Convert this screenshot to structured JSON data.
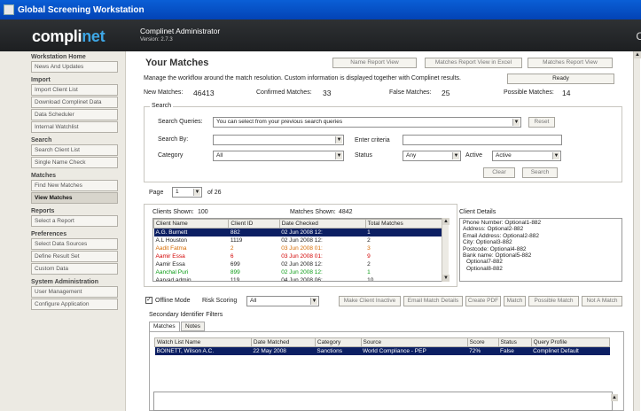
{
  "window": {
    "title": "Global Screening Workstation"
  },
  "brand": {
    "logo_main": "compli",
    "logo_accent": "net",
    "admin": "Complinet Administrator",
    "version": "Version: 2.7.3",
    "edge": "C"
  },
  "sidebar": {
    "sections": [
      {
        "title": "Workstation Home",
        "items": [
          {
            "label": "News And Updates"
          }
        ]
      },
      {
        "title": "Import",
        "items": [
          {
            "label": "Import Client List"
          },
          {
            "label": "Download Complinet Data"
          },
          {
            "label": "Data Scheduler"
          },
          {
            "label": "Internal Watchlist"
          }
        ]
      },
      {
        "title": "Search",
        "items": [
          {
            "label": "Search Client List"
          },
          {
            "label": "Single Name Check"
          }
        ]
      },
      {
        "title": "Matches",
        "items": [
          {
            "label": "Find New Matches"
          },
          {
            "label": "View Matches",
            "active": true
          }
        ]
      },
      {
        "title": "Reports",
        "items": [
          {
            "label": "Select a Report"
          }
        ]
      },
      {
        "title": "Preferences",
        "items": [
          {
            "label": "Select Data Sources"
          },
          {
            "label": "Define Result Set"
          },
          {
            "label": "Custom Data"
          }
        ]
      },
      {
        "title": "System Administration",
        "items": [
          {
            "label": "User Management"
          },
          {
            "label": "Configure Application"
          }
        ]
      }
    ]
  },
  "main": {
    "title": "Your Matches",
    "report_buttons": [
      "Name Report View",
      "Matches Report View in Excel",
      "Matches Report View"
    ],
    "description": "Manage the workflow around the match resolution. Custom information is displayed together with Complinet results.",
    "status": "Ready",
    "stats": {
      "new_label": "New Matches:",
      "new_value": "46413",
      "confirmed_label": "Confirmed Matches:",
      "confirmed_value": "33",
      "false_label": "False Matches:",
      "false_value": "25",
      "possible_label": "Possible Matches:",
      "possible_value": "14"
    },
    "search": {
      "legend": "Search",
      "queries_label": "Search Queries:",
      "queries_value": "You can select from your previous search queries",
      "reset": "Reset",
      "by_label": "Search By:",
      "criteria_label": "Enter criteria",
      "category_label": "Category",
      "category_value": "All",
      "status_label": "Status",
      "status_value": "Any",
      "active_label": "Active",
      "active_value": "Active",
      "clear": "Clear",
      "search": "Search"
    },
    "page": {
      "label": "Page",
      "value": "1",
      "of": "of 26"
    },
    "clients": {
      "shown_label": "Clients Shown:",
      "shown_value": "100",
      "matches_label": "Matches Shown:",
      "matches_value": "4842",
      "columns": [
        "Client Name",
        "Client ID",
        "Date Checked",
        "Total Matches"
      ],
      "rows": [
        {
          "name": "A.G. Burnett",
          "id": "882",
          "date": "02 Jun 2008 12:",
          "total": "1",
          "style": "sel"
        },
        {
          "name": "A.L Houston",
          "id": "1119",
          "date": "02 Jun 2008 12:",
          "total": "2",
          "style": ""
        },
        {
          "name": "Aadit Fatma",
          "id": "2",
          "date": "03 Jun 2008 01:",
          "total": "3",
          "style": "orange"
        },
        {
          "name": "Aamir Essa",
          "id": "6",
          "date": "03 Jun 2008 01:",
          "total": "9",
          "style": "red"
        },
        {
          "name": "Aamir Essa",
          "id": "699",
          "date": "02 Jun 2008 12:",
          "total": "2",
          "style": ""
        },
        {
          "name": "Aanchal Puri",
          "id": "899",
          "date": "02 Jun 2008 12:",
          "total": "1",
          "style": "green"
        },
        {
          "name": "Aarvad admin",
          "id": "119",
          "date": "04 Jun 2008 06:",
          "total": "10",
          "style": ""
        }
      ]
    },
    "details": {
      "label": "Client Details",
      "lines": [
        "Phone Number: Optional1-882",
        "Address: Optional2-882",
        "Email Address: Optional2-882",
        "City: Optional3-882",
        "Postcode: Optional4-882",
        "Bank name: Optional5-882",
        "Optional7-882",
        "Optional8-882"
      ]
    },
    "actions": {
      "offline": "Offline Mode",
      "risk": "Risk Scoring",
      "risk_value": "All",
      "buttons": [
        "Make Client Inactive",
        "Email Match Details",
        "Create PDF",
        "Match",
        "Possible Match",
        "Not A Match"
      ]
    },
    "secondary": {
      "label": "Secondary Identifier Filters",
      "tabs": [
        "Matches",
        "Notes"
      ],
      "columns": [
        "Watch List Name",
        "Date Matched",
        "Category",
        "Source",
        "Score",
        "Status",
        "Query Profile"
      ],
      "rows": [
        {
          "name": "BOINETT, Wilson A.C.",
          "date": "22 May 2008",
          "category": "Sanctions",
          "source": "World Compliance - PEP",
          "score": "72%",
          "status": "False",
          "profile": "Complinet Default"
        }
      ]
    }
  }
}
